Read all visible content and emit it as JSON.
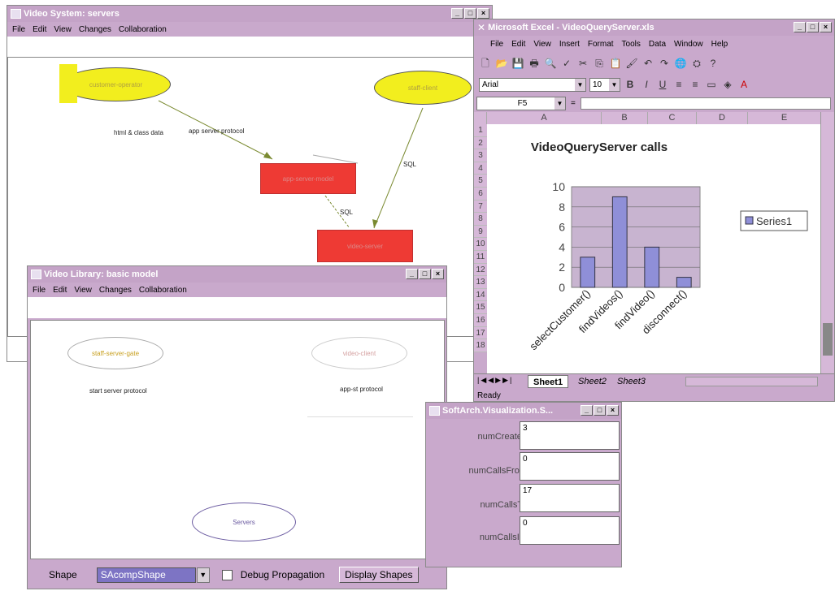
{
  "video_system": {
    "title": "Video System: servers",
    "menu": [
      "File",
      "Edit",
      "View",
      "Changes",
      "Collaboration"
    ],
    "edge_labels": [
      "html & class data",
      "app server protocol",
      "SQL",
      "SQL"
    ],
    "node_labels": [
      "customer-operator",
      "staff-client",
      "app-server-model",
      "video-server"
    ]
  },
  "excel": {
    "title": "Microsoft Excel - VideoQueryServer.xls",
    "menu": [
      "File",
      "Edit",
      "View",
      "Insert",
      "Format",
      "Tools",
      "Data",
      "Window",
      "Help"
    ],
    "font_name": "Arial",
    "font_size": "10",
    "cell_ref": "F5",
    "columns": [
      "A",
      "B",
      "C",
      "D",
      "E"
    ],
    "rows": [
      "1",
      "2",
      "3",
      "4",
      "5",
      "6",
      "7",
      "8",
      "9",
      "10",
      "11",
      "12",
      "13",
      "14",
      "15",
      "16",
      "17",
      "18"
    ],
    "sheets": [
      "Sheet1",
      "Sheet2",
      "Sheet3"
    ],
    "status": "Ready",
    "chart_colors": {
      "bar": "#8f8fd8",
      "plot_bg": "#c8b4d0"
    }
  },
  "chart_data": {
    "type": "bar",
    "title": "VideoQueryServer calls",
    "categories": [
      "selectCustomer()",
      "findVideos()",
      "findVideo()",
      "disconnect()"
    ],
    "series": [
      {
        "name": "Series1",
        "values": [
          3,
          9,
          4,
          1
        ]
      }
    ],
    "ylim": [
      0,
      10
    ],
    "yticks": [
      "0",
      "2",
      "4",
      "6",
      "8",
      "10"
    ],
    "legend": "right",
    "grid": true
  },
  "video_library": {
    "title": "Video Library: basic model",
    "menu": [
      "File",
      "Edit",
      "View",
      "Changes",
      "Collaboration"
    ],
    "edge_labels": [
      "start server protocol",
      "app-st protocol"
    ],
    "node_labels": [
      "staff-server-gate",
      "video-client",
      "Servers"
    ],
    "shape_label": "Shape",
    "shape_value": "SAcompShape",
    "debug_label": "Debug Propagation",
    "display_button": "Display Shapes"
  },
  "softarch": {
    "title": "SoftArch.Visualization.S...",
    "fields": [
      {
        "label": "numCreated",
        "value": "3"
      },
      {
        "label": "numCallsFrom",
        "value": "0"
      },
      {
        "label": "numCallsTo",
        "value": "17"
      },
      {
        "label": "numCallsInt",
        "value": "0"
      }
    ]
  }
}
